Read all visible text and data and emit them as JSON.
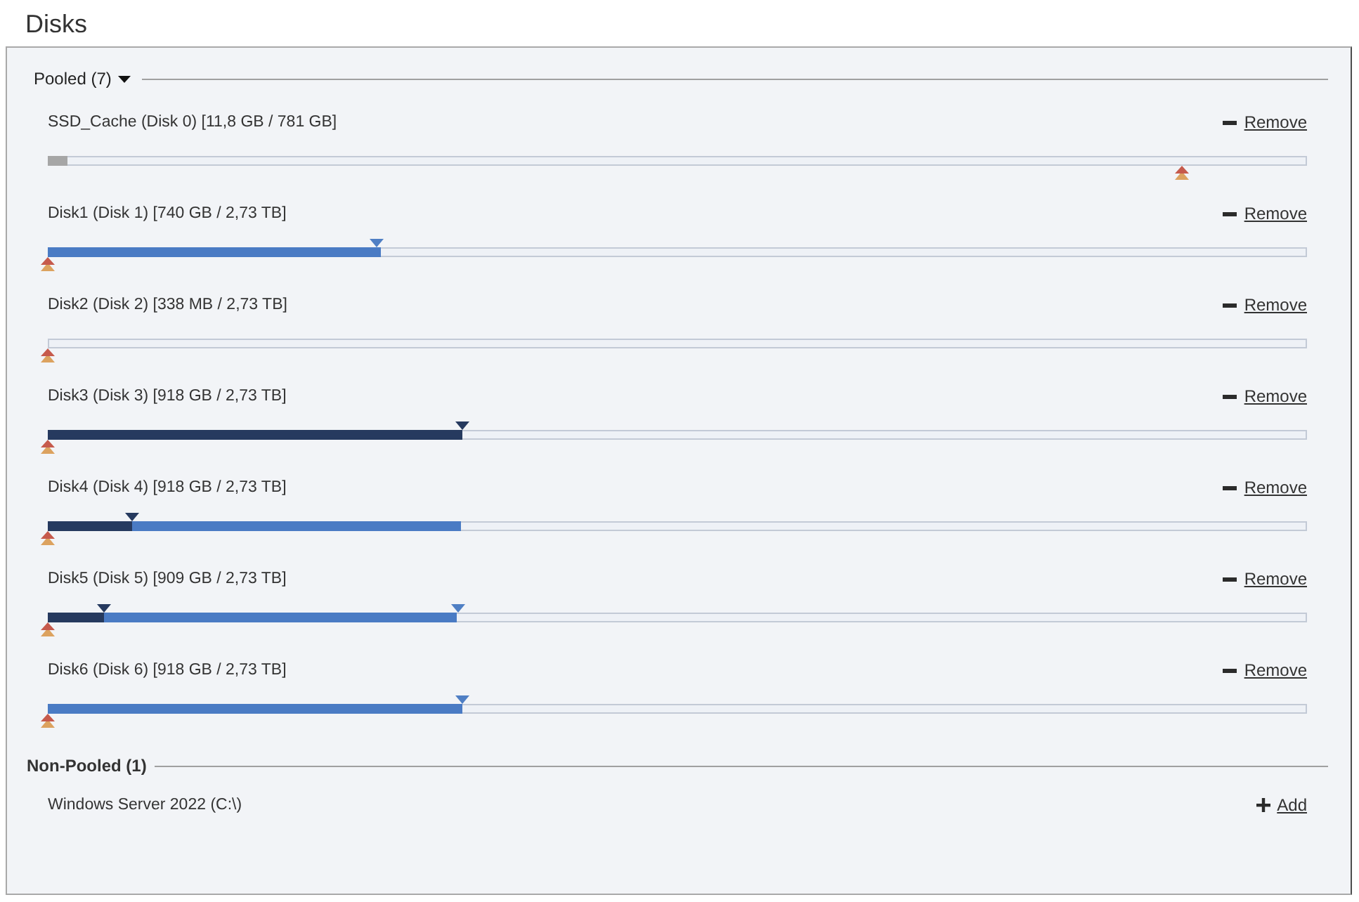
{
  "title": "Disks",
  "groups": [
    {
      "kind": "dropdown",
      "title": "Pooled (7)",
      "expanded": true,
      "disks": [
        {
          "label": "SSD_Cache (Disk 0) [11,8 GB / 781 GB]",
          "action": {
            "kind": "remove",
            "text": "Remove"
          },
          "bar": {
            "segments": [
              {
                "color": "#a6a6a6",
                "level": 0.016
              }
            ],
            "markers": [
              {
                "kind": "arrows",
                "level": 0.901
              }
            ]
          }
        },
        {
          "label": "Disk1 (Disk 1) [740 GB / 2,73 TB]",
          "action": {
            "kind": "remove",
            "text": "Remove"
          },
          "bar": {
            "segments": [
              {
                "color": "#4a7bc4",
                "level": 0.265
              }
            ],
            "markers": [
              {
                "kind": "triangle",
                "color": "#4f7fc4",
                "level": 0.261
              },
              {
                "kind": "arrows",
                "level": 0
              }
            ]
          }
        },
        {
          "label": "Disk2 (Disk 2) [338 MB / 2,73 TB]",
          "action": {
            "kind": "remove",
            "text": "Remove"
          },
          "bar": {
            "markers": [
              {
                "kind": "arrows",
                "level": 0
              }
            ]
          }
        },
        {
          "label": "Disk3 (Disk 3) [918 GB / 2,73 TB]",
          "action": {
            "kind": "remove",
            "text": "Remove"
          },
          "bar": {
            "segments": [
              {
                "color": "#263a5f",
                "level": 0.329
              }
            ],
            "markers": [
              {
                "kind": "triangle",
                "color": "#263a5f",
                "level": 0.329
              },
              {
                "kind": "arrows",
                "level": 0
              }
            ]
          }
        },
        {
          "label": "Disk4 (Disk 4) [918 GB / 2,73 TB]",
          "action": {
            "kind": "remove",
            "text": "Remove"
          },
          "bar": {
            "segments": [
              {
                "color": "#4a7bc4",
                "level": 0.328
              },
              {
                "color": "#263a5f",
                "level": 0.067
              }
            ],
            "markers": [
              {
                "kind": "triangle",
                "color": "#263a5f",
                "level": 0.067
              },
              {
                "kind": "arrows",
                "level": 0
              }
            ]
          }
        },
        {
          "label": "Disk5 (Disk 5) [909 GB / 2,73 TB]",
          "action": {
            "kind": "remove",
            "text": "Remove"
          },
          "bar": {
            "segments": [
              {
                "color": "#4a7bc4",
                "level": 0.325
              },
              {
                "color": "#263a5f",
                "level": 0.045
              }
            ],
            "markers": [
              {
                "kind": "triangle",
                "color": "#263a5f",
                "level": 0.045
              },
              {
                "kind": "triangle",
                "color": "#4f7fc4",
                "level": 0.326
              },
              {
                "kind": "arrows",
                "level": 0
              }
            ]
          }
        },
        {
          "label": "Disk6 (Disk 6) [918 GB / 2,73 TB]",
          "action": {
            "kind": "remove",
            "text": "Remove"
          },
          "bar": {
            "segments": [
              {
                "color": "#4a7bc4",
                "level": 0.329
              }
            ],
            "markers": [
              {
                "kind": "triangle",
                "color": "#4f7fc4",
                "level": 0.329
              },
              {
                "kind": "arrows",
                "level": 0
              }
            ]
          }
        }
      ]
    },
    {
      "kind": "heading",
      "title": "Non-Pooled (1)",
      "disks": [
        {
          "label": "Windows Server 2022 (C:\\)",
          "action": {
            "kind": "add",
            "text": "Add"
          }
        }
      ]
    }
  ]
}
